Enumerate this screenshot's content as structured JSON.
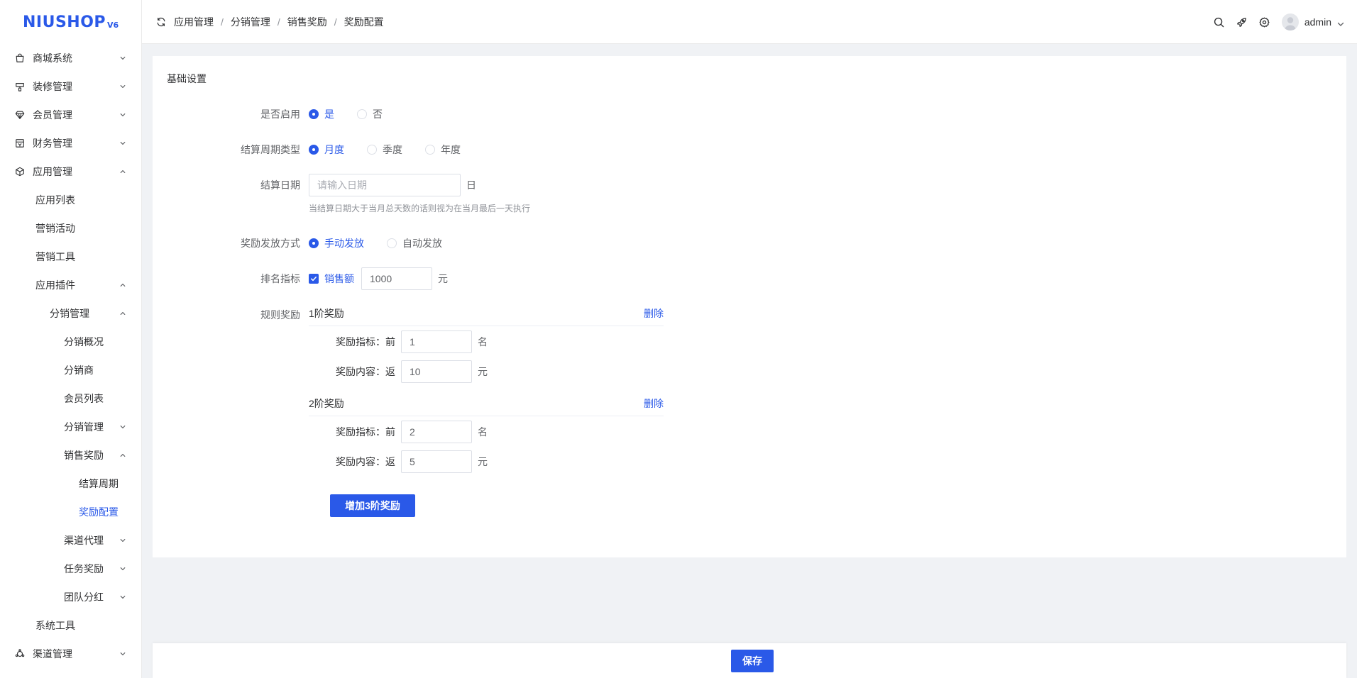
{
  "brand": {
    "logo_text": "NIUSHOP",
    "logo_version": "V6",
    "accent": "#2a59e8"
  },
  "sidebar": {
    "items": [
      {
        "label": "商城系统",
        "level": 0,
        "icon": "bag-icon",
        "expanded": false,
        "has_children": true
      },
      {
        "label": "装修管理",
        "level": 0,
        "icon": "brush-icon",
        "expanded": false,
        "has_children": true
      },
      {
        "label": "会员管理",
        "level": 0,
        "icon": "diamond-icon",
        "expanded": false,
        "has_children": true
      },
      {
        "label": "财务管理",
        "level": 0,
        "icon": "finance-icon",
        "expanded": false,
        "has_children": true
      },
      {
        "label": "应用管理",
        "level": 0,
        "icon": "cube-icon",
        "expanded": true,
        "has_children": true
      },
      {
        "label": "应用列表",
        "level": 1,
        "has_children": false
      },
      {
        "label": "营销活动",
        "level": 1,
        "has_children": false
      },
      {
        "label": "营销工具",
        "level": 1,
        "has_children": false
      },
      {
        "label": "应用插件",
        "level": 1,
        "expanded": true,
        "has_children": true
      },
      {
        "label": "分销管理",
        "level": 2,
        "expanded": true,
        "has_children": true
      },
      {
        "label": "分销概况",
        "level": 3,
        "has_children": false
      },
      {
        "label": "分销商",
        "level": 3,
        "has_children": false
      },
      {
        "label": "会员列表",
        "level": 3,
        "has_children": false
      },
      {
        "label": "分销管理",
        "level": 3,
        "expanded": false,
        "has_children": true
      },
      {
        "label": "销售奖励",
        "level": 3,
        "expanded": true,
        "has_children": true
      },
      {
        "label": "结算周期",
        "level": 4,
        "has_children": false
      },
      {
        "label": "奖励配置",
        "level": 4,
        "has_children": false,
        "active": true
      },
      {
        "label": "渠道代理",
        "level": 3,
        "expanded": false,
        "has_children": true
      },
      {
        "label": "任务奖励",
        "level": 3,
        "expanded": false,
        "has_children": true
      },
      {
        "label": "团队分红",
        "level": 3,
        "expanded": false,
        "has_children": true
      },
      {
        "label": "系统工具",
        "level": 1,
        "has_children": false
      },
      {
        "label": "渠道管理",
        "level": 0,
        "icon": "channel-icon",
        "expanded": false,
        "has_children": true
      }
    ]
  },
  "header": {
    "breadcrumbs": [
      "应用管理",
      "分销管理",
      "销售奖励",
      "奖励配置"
    ],
    "separator": "/",
    "user": "admin"
  },
  "form": {
    "section_title": "基础设置",
    "enable": {
      "label": "是否启用",
      "options": [
        "是",
        "否"
      ],
      "selected": 0
    },
    "cycle": {
      "label": "结算周期类型",
      "options": [
        "月度",
        "季度",
        "年度"
      ],
      "selected": 0
    },
    "date": {
      "label": "结算日期",
      "placeholder": "请输入日期",
      "value": "",
      "unit": "日",
      "hint": "当结算日期大于当月总天数的话则视为在当月最后一天执行"
    },
    "payout": {
      "label": "奖励发放方式",
      "options": [
        "手动发放",
        "自动发放"
      ],
      "selected": 0
    },
    "ranking": {
      "label": "排名指标",
      "checkbox_label": "销售额",
      "checked": true,
      "value": "1000",
      "unit": "元"
    },
    "rules": {
      "label": "规则奖励",
      "delete_label": "删除",
      "tiers": [
        {
          "title": "1阶奖励",
          "indicator_label": "奖励指标：前",
          "indicator_value": "1",
          "indicator_unit": "名",
          "content_label": "奖励内容：返",
          "content_value": "10",
          "content_unit": "元"
        },
        {
          "title": "2阶奖励",
          "indicator_label": "奖励指标：前",
          "indicator_value": "2",
          "indicator_unit": "名",
          "content_label": "奖励内容：返",
          "content_value": "5",
          "content_unit": "元"
        }
      ],
      "add_label": "增加3阶奖励"
    }
  },
  "footer": {
    "save_label": "保存"
  }
}
